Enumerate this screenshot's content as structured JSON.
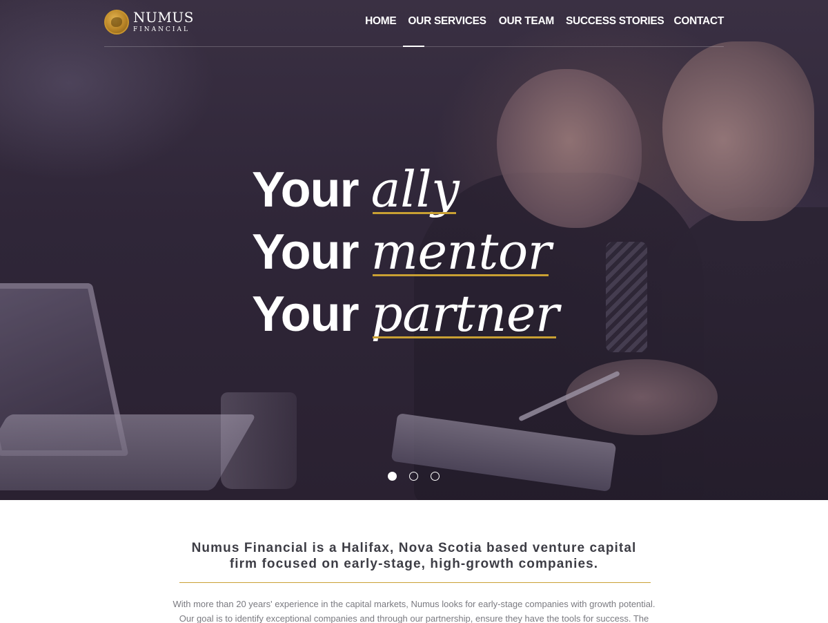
{
  "brand": {
    "name": "NUMUS",
    "subtitle": "FINANCIAL",
    "accent_color": "#c9a033"
  },
  "nav": {
    "items": [
      "HOME",
      "OUR SERVICES",
      "OUR TEAM",
      "SUCCESS STORIES",
      "CONTACT"
    ],
    "active": "HOME"
  },
  "hero": {
    "lines": [
      {
        "lead": "Your",
        "emphasis": "ally"
      },
      {
        "lead": "Your",
        "emphasis": "mentor"
      },
      {
        "lead": "Your",
        "emphasis": "partner"
      }
    ],
    "slider": {
      "slides": 3,
      "active_index": 0
    }
  },
  "intro": {
    "title_line1": "Numus Financial is a Halifax, Nova Scotia based venture capital",
    "title_line2": "firm focused on early-stage, high-growth companies.",
    "body_line1": "With more than 20 years' experience in the capital markets, Numus looks for early-stage companies with growth potential.",
    "body_line2": "Our goal is to identify exceptional companies and through our partnership, ensure they have the tools for success. The"
  }
}
